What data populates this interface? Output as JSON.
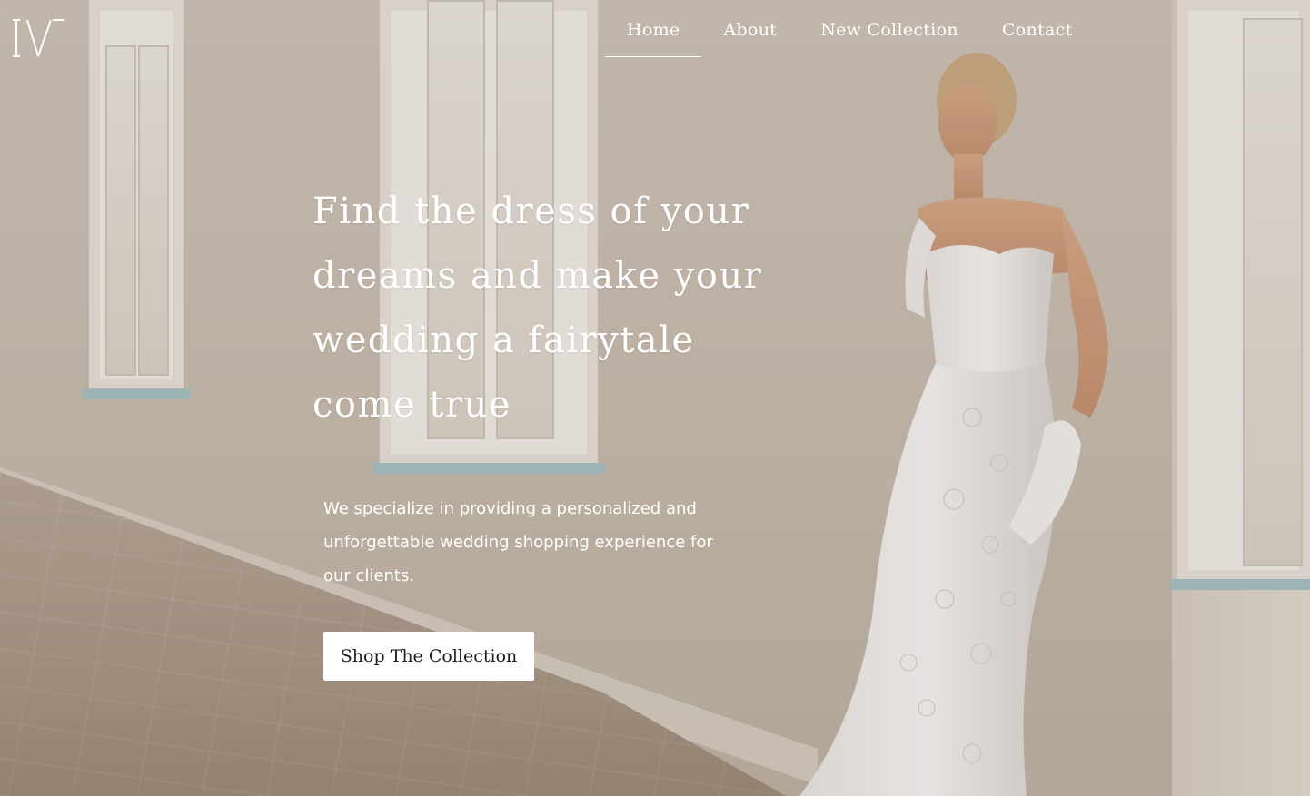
{
  "nav": {
    "items": [
      {
        "label": "Home",
        "active": true
      },
      {
        "label": "About",
        "active": false
      },
      {
        "label": "New Collection",
        "active": false
      },
      {
        "label": "Contact",
        "active": false
      }
    ]
  },
  "hero": {
    "headline": "Find the dress of your dreams and make your wedding a fairytale come true",
    "subtext": "We specialize in providing a personalized and unforgettable wedding shopping experience for our clients.",
    "cta_label": "Shop The Collection"
  },
  "logo": {
    "icon": "brand-monogram-icon"
  },
  "colors": {
    "text": "#ffffff",
    "button_bg": "#ffffff",
    "button_text": "#1e1e1e"
  }
}
